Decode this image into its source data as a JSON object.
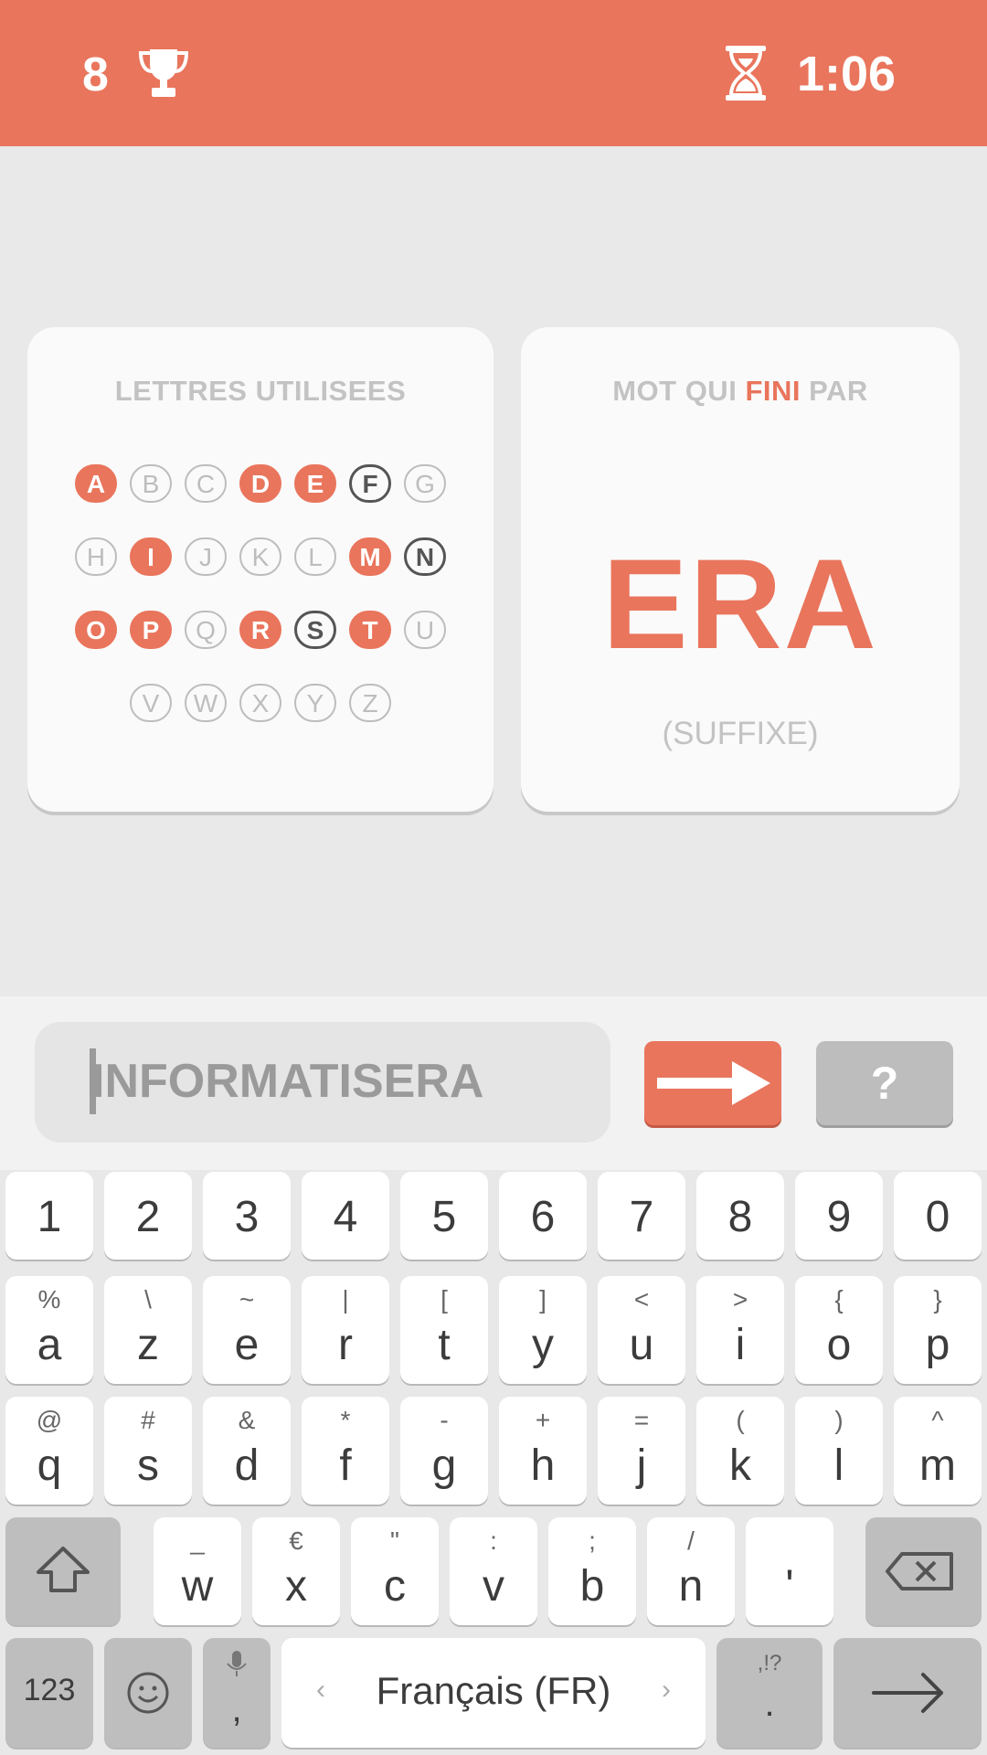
{
  "header": {
    "score": "8",
    "timer": "1:06"
  },
  "letters_card": {
    "title": "LETTRES UTILISEES",
    "letters": [
      {
        "ch": "A",
        "state": "used"
      },
      {
        "ch": "B",
        "state": "unused"
      },
      {
        "ch": "C",
        "state": "unused"
      },
      {
        "ch": "D",
        "state": "used"
      },
      {
        "ch": "E",
        "state": "used"
      },
      {
        "ch": "F",
        "state": "outlined"
      },
      {
        "ch": "G",
        "state": "unused"
      },
      {
        "ch": "H",
        "state": "unused"
      },
      {
        "ch": "I",
        "state": "used"
      },
      {
        "ch": "J",
        "state": "unused"
      },
      {
        "ch": "K",
        "state": "unused"
      },
      {
        "ch": "L",
        "state": "unused"
      },
      {
        "ch": "M",
        "state": "used"
      },
      {
        "ch": "N",
        "state": "outlined"
      },
      {
        "ch": "O",
        "state": "used"
      },
      {
        "ch": "P",
        "state": "used"
      },
      {
        "ch": "Q",
        "state": "unused"
      },
      {
        "ch": "R",
        "state": "used"
      },
      {
        "ch": "S",
        "state": "outlined"
      },
      {
        "ch": "T",
        "state": "used"
      },
      {
        "ch": "U",
        "state": "unused"
      },
      {
        "ch": "V",
        "state": "unused"
      },
      {
        "ch": "W",
        "state": "unused"
      },
      {
        "ch": "X",
        "state": "unused"
      },
      {
        "ch": "Y",
        "state": "unused"
      },
      {
        "ch": "Z",
        "state": "unused"
      }
    ]
  },
  "suffix_card": {
    "title_pre": "MOT QUI",
    "title_accent": "FINI",
    "title_post": "PAR",
    "suffix": "ERA",
    "note": "(SUFFIXE)"
  },
  "input": {
    "value": "INFORMATISERA",
    "hint_label": "?"
  },
  "keyboard": {
    "numbers": [
      "1",
      "2",
      "3",
      "4",
      "5",
      "6",
      "7",
      "8",
      "9",
      "0"
    ],
    "row1": [
      {
        "m": "a",
        "h": "%"
      },
      {
        "m": "z",
        "h": "\\"
      },
      {
        "m": "e",
        "h": "~"
      },
      {
        "m": "r",
        "h": "|"
      },
      {
        "m": "t",
        "h": "["
      },
      {
        "m": "y",
        "h": "]"
      },
      {
        "m": "u",
        "h": "<"
      },
      {
        "m": "i",
        "h": ">"
      },
      {
        "m": "o",
        "h": "{"
      },
      {
        "m": "p",
        "h": "}"
      }
    ],
    "row2": [
      {
        "m": "q",
        "h": "@"
      },
      {
        "m": "s",
        "h": "#"
      },
      {
        "m": "d",
        "h": "&"
      },
      {
        "m": "f",
        "h": "*"
      },
      {
        "m": "g",
        "h": "-"
      },
      {
        "m": "h",
        "h": "+"
      },
      {
        "m": "j",
        "h": "="
      },
      {
        "m": "k",
        "h": "("
      },
      {
        "m": "l",
        "h": ")"
      },
      {
        "m": "m",
        "h": "^"
      }
    ],
    "row3": [
      {
        "m": "w",
        "h": "_"
      },
      {
        "m": "x",
        "h": "€"
      },
      {
        "m": "c",
        "h": "\""
      },
      {
        "m": "v",
        "h": ":"
      },
      {
        "m": "b",
        "h": ";"
      },
      {
        "m": "n",
        "h": "/"
      },
      {
        "m": "'",
        "h": ""
      }
    ],
    "bottom": {
      "symbols": "123",
      "comma": ",",
      "space": "Français (FR)",
      "period": ".",
      "period_hint": ",!?"
    }
  },
  "colors": {
    "accent": "#e9755c",
    "inactive": "#bdbdbd"
  }
}
